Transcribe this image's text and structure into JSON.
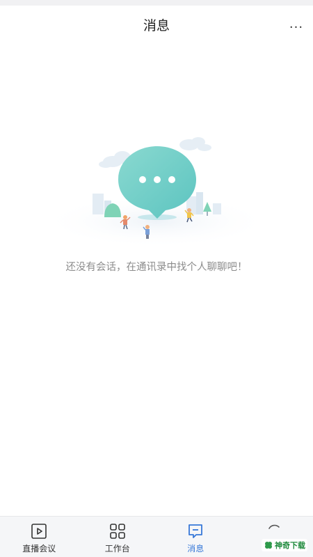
{
  "header": {
    "title": "消息",
    "more_label": "..."
  },
  "empty_state": {
    "message": "还没有会话，在通讯录中找个人聊聊吧！"
  },
  "tabs": [
    {
      "label": "直播会议",
      "icon": "play-box-icon",
      "active": false
    },
    {
      "label": "工作台",
      "icon": "grid-icon",
      "active": false
    },
    {
      "label": "消息",
      "icon": "chat-bubble-icon",
      "active": true
    },
    {
      "label": "",
      "icon": "loading-spinner-icon",
      "active": false
    }
  ],
  "watermark": {
    "text": "神奇下载"
  },
  "colors": {
    "accent": "#3778d8",
    "bubble": "#7fd6cc",
    "text_muted": "#8c8c8c"
  }
}
